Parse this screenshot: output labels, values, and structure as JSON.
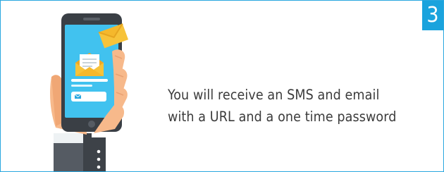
{
  "step": {
    "number": "3"
  },
  "message": {
    "line1": "You will receive an SMS and email",
    "line2": "with a  URL and a one time password"
  },
  "icons": {
    "phone": "smartphone-in-hand-icon",
    "email": "envelope-icon"
  },
  "colors": {
    "accent": "#1aa3dd",
    "border": "#2aa7df",
    "text": "#3b3b3b",
    "envelope": "#f5c02f"
  }
}
